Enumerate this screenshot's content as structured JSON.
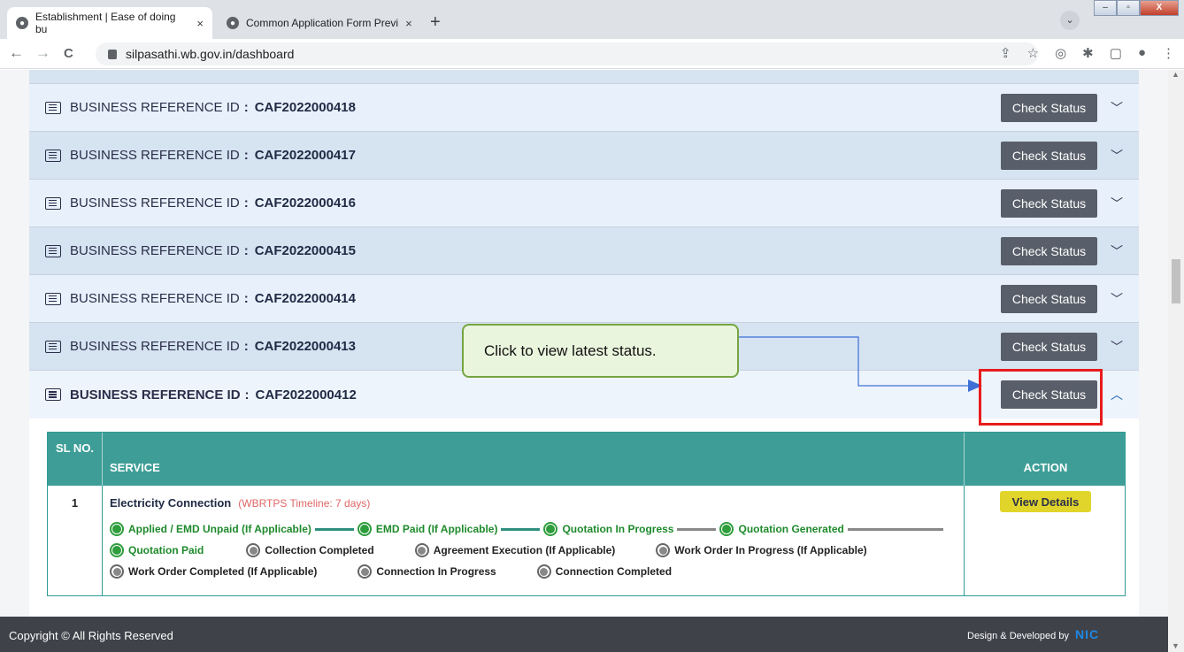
{
  "browser": {
    "tabs": [
      {
        "title": "Establishment | Ease of doing bu",
        "close": "×"
      },
      {
        "title": "Common Application Form Previ",
        "close": "×"
      }
    ],
    "new_tab": "+",
    "url": "silpasathi.wb.gov.in/dashboard",
    "nav": {
      "back": "←",
      "forward": "→",
      "reload": "C"
    },
    "toolbar_icons": [
      "share-icon",
      "star-icon",
      "camera-icon",
      "extension-icon",
      "sidebar-icon",
      "profile-icon",
      "menu-icon"
    ],
    "window_controls": [
      "minimize",
      "maximize",
      "close"
    ]
  },
  "rows": [
    {
      "label": "BUSINESS REFERENCE ID",
      "separator": ":",
      "id": "CAF2022000418",
      "button": "Check Status",
      "expanded": false
    },
    {
      "label": "BUSINESS REFERENCE ID",
      "separator": ":",
      "id": "CAF2022000417",
      "button": "Check Status",
      "expanded": false
    },
    {
      "label": "BUSINESS REFERENCE ID",
      "separator": ":",
      "id": "CAF2022000416",
      "button": "Check Status",
      "expanded": false
    },
    {
      "label": "BUSINESS REFERENCE ID",
      "separator": ":",
      "id": "CAF2022000415",
      "button": "Check Status",
      "expanded": false
    },
    {
      "label": "BUSINESS REFERENCE ID",
      "separator": ":",
      "id": "CAF2022000414",
      "button": "Check Status",
      "expanded": false
    },
    {
      "label": "BUSINESS REFERENCE ID",
      "separator": ":",
      "id": "CAF2022000413",
      "button": "Check Status",
      "expanded": false
    },
    {
      "label": "BUSINESS REFERENCE ID",
      "separator": ":",
      "id": "CAF2022000412",
      "button": "Check Status",
      "expanded": true
    }
  ],
  "table": {
    "headers": {
      "sl": "SL NO.",
      "service": "SERVICE",
      "action": "ACTION"
    },
    "rows": [
      {
        "sl": "1",
        "service": "Electricity Connection",
        "timeline": "(WBRTPS Timeline: 7 days)",
        "action": "View Details",
        "statuses": [
          {
            "label": "Applied / EMD Unpaid (If Applicable)",
            "done": true
          },
          {
            "label": "EMD Paid (If Applicable)",
            "done": true
          },
          {
            "label": "Quotation In Progress",
            "done": true
          },
          {
            "label": "Quotation Generated",
            "done": true
          },
          {
            "label": "Quotation Paid",
            "done": true
          },
          {
            "label": "Collection Completed",
            "done": false
          },
          {
            "label": "Agreement Execution (If Applicable)",
            "done": false
          },
          {
            "label": "Work Order In Progress (If Applicable)",
            "done": false
          },
          {
            "label": "Work Order Completed (If Applicable)",
            "done": false
          },
          {
            "label": "Connection In Progress",
            "done": false
          },
          {
            "label": "Connection Completed",
            "done": false
          }
        ]
      }
    ]
  },
  "callout": {
    "text": "Click to view latest status."
  },
  "footer": {
    "copyright": "Copyright © All Rights Reserved",
    "developer": "Design & Developed by",
    "logo": "NIC"
  },
  "colors": {
    "teal_header": "#3e9e97",
    "check_button": "#595f6a",
    "view_details": "#e1d52b",
    "done_status": "#2e9d3c",
    "highlight": "#e81c1c"
  }
}
